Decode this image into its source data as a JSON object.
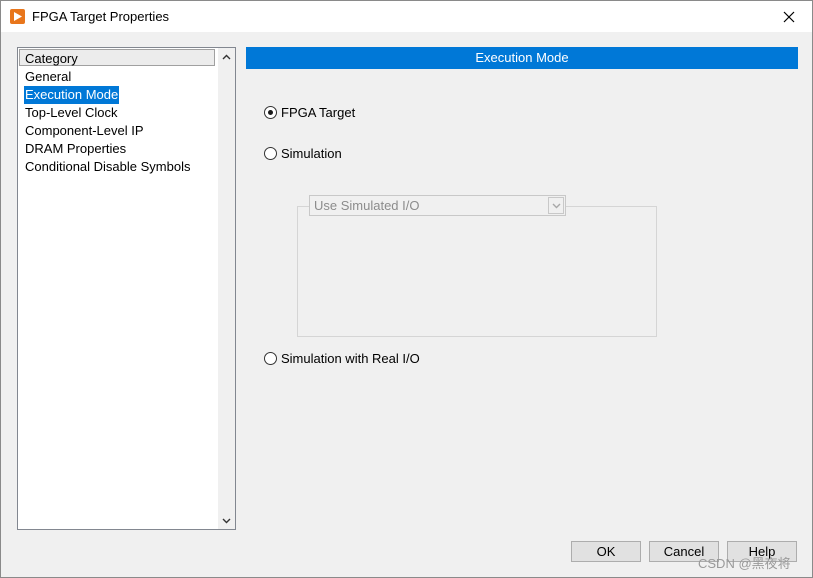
{
  "window": {
    "title": "FPGA Target Properties"
  },
  "category_panel": {
    "header": "Category",
    "items": [
      {
        "label": "General",
        "selected": false
      },
      {
        "label": "Execution Mode",
        "selected": true
      },
      {
        "label": "Top-Level Clock",
        "selected": false
      },
      {
        "label": "Component-Level IP",
        "selected": false
      },
      {
        "label": "DRAM Properties",
        "selected": false
      },
      {
        "label": "Conditional Disable Symbols",
        "selected": false
      }
    ]
  },
  "main": {
    "section_title": "Execution Mode",
    "options": [
      {
        "label": "FPGA Target",
        "checked": true
      },
      {
        "label": "Simulation",
        "checked": false
      },
      {
        "label": "Simulation with Real I/O",
        "checked": false
      }
    ],
    "simulation_select": {
      "value": "Use Simulated I/O",
      "disabled": true
    }
  },
  "buttons": {
    "ok": "OK",
    "cancel": "Cancel",
    "help": "Help"
  },
  "watermark": "CSDN @黑夜将",
  "colors": {
    "accent": "#0078d7",
    "app_icon": "#e8761c"
  },
  "icons": {
    "app": "labview-run-arrow-icon",
    "close": "close-icon",
    "scroll_up": "chevron-up-icon",
    "scroll_down": "chevron-down-icon",
    "dropdown": "chevron-down-icon"
  }
}
